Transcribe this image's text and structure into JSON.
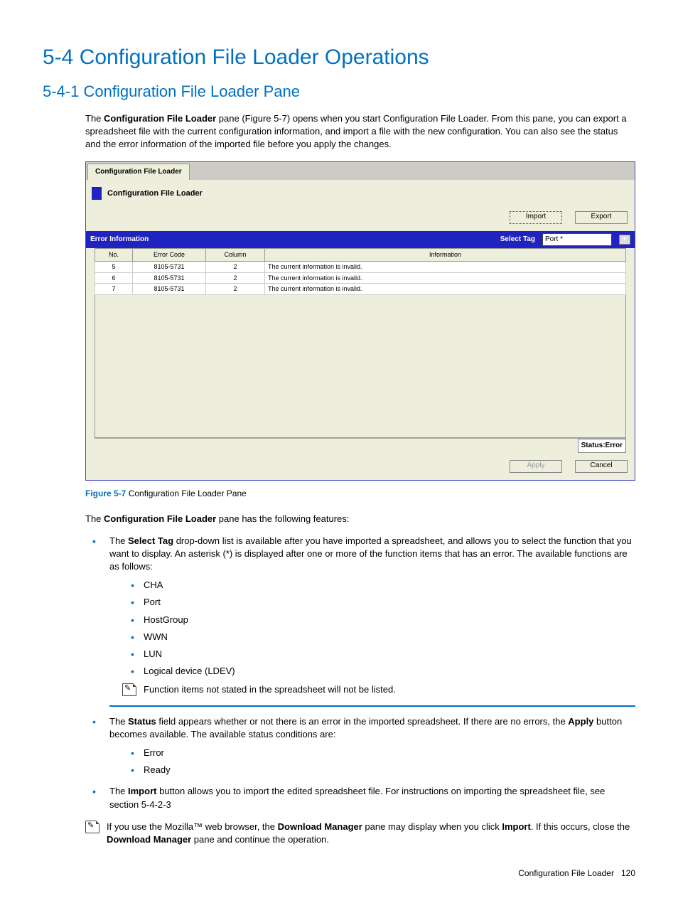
{
  "h1": "5-4 Configuration File Loader Operations",
  "h2": "5-4-1 Configuration File Loader Pane",
  "intro_before_bold": "The ",
  "intro_bold": "Configuration File Loader",
  "intro_after_bold": " pane (Figure 5-7) opens when you start Configuration File Loader. From this pane, you can export a spreadsheet file with the current configuration information, and import a file with the new configuration. You can also see the status and the error information of the imported file before you apply the changes.",
  "fig": {
    "tab": "Configuration File Loader",
    "title": "Configuration File Loader",
    "import_btn": "Import",
    "export_btn": "Export",
    "err_header": "Error Information",
    "select_label": "Select Tag",
    "select_val": "Port  *",
    "cols": {
      "no": "No.",
      "code": "Error Code",
      "col": "Column",
      "info": "Information"
    },
    "rows": [
      {
        "no": "5",
        "code": "8105-5731",
        "col": "2",
        "info": "The current  information is invalid."
      },
      {
        "no": "6",
        "code": "8105-5731",
        "col": "2",
        "info": "The current  information is invalid."
      },
      {
        "no": "7",
        "code": "8105-5731",
        "col": "2",
        "info": "The current  information is invalid."
      }
    ],
    "status": "Status:Error",
    "apply_btn": "Apply",
    "cancel_btn": "Cancel"
  },
  "caption": {
    "label": "Figure 5-7",
    "text": " Configuration File Loader Pane"
  },
  "features_before": "The ",
  "features_bold": "Configuration File Loader",
  "features_after": " pane has the following features:",
  "b1": {
    "pre": "The ",
    "b": "Select Tag",
    "post": " drop-down list is available after you have imported a spreadsheet, and allows you to select the function that you want to display. An asterisk (*) is displayed after one or more of the function items that has an error. The available functions are as follows:",
    "items": [
      "CHA",
      "Port",
      "HostGroup",
      "WWN",
      "LUN",
      "Logical device (LDEV)"
    ],
    "note": "Function items not stated in the spreadsheet will not be listed."
  },
  "b2": {
    "pre": "The ",
    "b1": "Status",
    "mid": " field appears whether or not there is an error in the imported spreadsheet. If there are no errors, the ",
    "b2": "Apply",
    "post": " button becomes available. The available status conditions are:",
    "items": [
      "Error",
      "Ready"
    ]
  },
  "b3": {
    "pre": "The ",
    "b": "Import",
    "post": " button allows you to import the edited spreadsheet file. For instructions on importing the spreadsheet file, see section 5-4-2-3"
  },
  "note2": {
    "p1a": "If you use the Mozilla™ web browser, the ",
    "p1b": "Download Manager",
    "p1c": " pane may display when you click ",
    "p1d": "Import",
    "p1e": ". If this occurs, close the ",
    "p1f": "Download Manager",
    "p1g": " pane and continue the operation."
  },
  "footer": {
    "text": "Configuration File Loader",
    "page": "120"
  }
}
